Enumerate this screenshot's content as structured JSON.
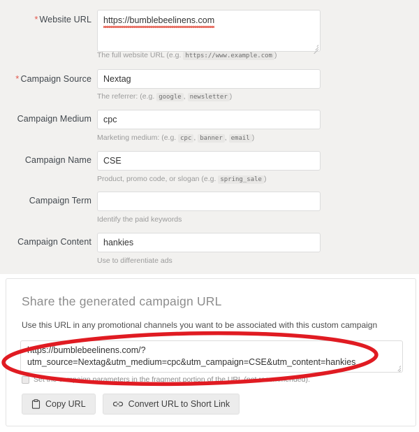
{
  "form": {
    "rows": [
      {
        "label": "Website URL",
        "required": true,
        "value": "https://bumblebeelinens.com",
        "hint_prefix": "The full website URL (e.g. ",
        "hint_codes": [
          "https://www.example.com"
        ],
        "hint_suffix": ")",
        "type": "textarea"
      },
      {
        "label": "Campaign Source",
        "required": true,
        "value": "Nextag",
        "hint_prefix": "The referrer: (e.g. ",
        "hint_codes": [
          "google",
          "newsletter"
        ],
        "hint_suffix": ")",
        "type": "input"
      },
      {
        "label": "Campaign Medium",
        "required": false,
        "value": "cpc",
        "hint_prefix": "Marketing medium: (e.g. ",
        "hint_codes": [
          "cpc",
          "banner",
          "email"
        ],
        "hint_suffix": ")",
        "type": "input"
      },
      {
        "label": "Campaign Name",
        "required": false,
        "value": "CSE",
        "hint_prefix": "Product, promo code, or slogan (e.g. ",
        "hint_codes": [
          "spring_sale"
        ],
        "hint_suffix": ")",
        "type": "input"
      },
      {
        "label": "Campaign Term",
        "required": false,
        "value": "",
        "hint_prefix": "Identify the paid keywords",
        "hint_codes": [],
        "hint_suffix": "",
        "type": "input"
      },
      {
        "label": "Campaign Content",
        "required": false,
        "value": "hankies",
        "hint_prefix": "Use to differentiate ads",
        "hint_codes": [],
        "hint_suffix": "",
        "type": "input"
      }
    ],
    "required_marker": "*"
  },
  "share": {
    "title": "Share the generated campaign URL",
    "description": "Use this URL in any promotional channels you want to be associated with this custom campaign",
    "generated_url_line1": "https://bumblebeelinens.com/?",
    "generated_url_line2": "utm_source=Nextag&utm_medium=cpc&utm_campaign=CSE&utm_content=hankies",
    "fragment_checkbox_label": "Set the campaign parameters in the fragment portion of the URL (not recommended).",
    "fragment_checkbox_checked": false,
    "copy_button_label": "Copy URL",
    "shortlink_button_label": "Convert URL to Short Link"
  },
  "annotation": {
    "shape": "ellipse",
    "color": "#e01b22"
  },
  "colors": {
    "page_background": "#f2f1ef",
    "panel_background": "#ffffff",
    "required_star": "#e2574c",
    "annotation_red": "#e01b22",
    "button_background": "#ececec"
  }
}
